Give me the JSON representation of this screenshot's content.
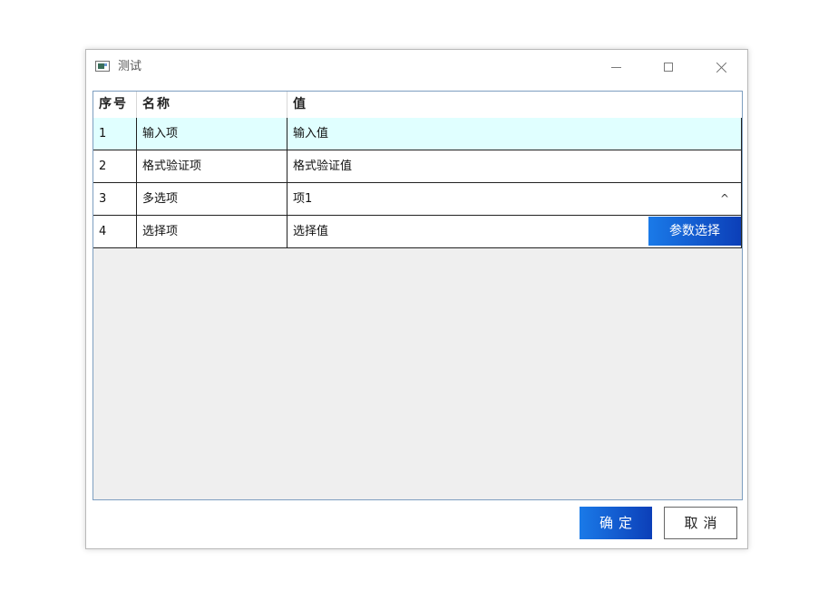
{
  "window": {
    "title": "测试",
    "icon": "app-window-icon",
    "controls": {
      "minimize": "minimize-icon",
      "maximize": "maximize-icon",
      "close": "close-icon"
    }
  },
  "table": {
    "headers": [
      "序号",
      "名称",
      "值"
    ],
    "rows": [
      {
        "no": "1",
        "name": "输入项",
        "value": "输入值",
        "selected": true
      },
      {
        "no": "2",
        "name": "格式验证项",
        "value": "格式验证值"
      },
      {
        "no": "3",
        "name": "多选项",
        "value": "项1",
        "indicator": "^"
      },
      {
        "no": "4",
        "name": "选择项",
        "value": "选择值",
        "button": "参数选择"
      }
    ],
    "colors": {
      "selected_row": "#e0ffff",
      "empty_area": "#efefef",
      "accent_start": "#1a7ae8",
      "accent_end": "#0c3fb8"
    }
  },
  "footer": {
    "ok_label": "确定",
    "cancel_label": "取消"
  }
}
